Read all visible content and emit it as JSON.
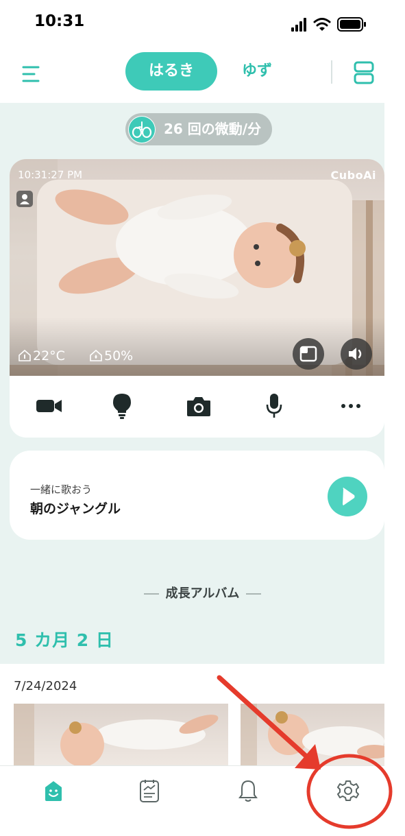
{
  "status_bar": {
    "time": "10:31",
    "icons": [
      "cellular-signal-icon",
      "wifi-icon",
      "battery-icon"
    ]
  },
  "header": {
    "menu_icon": "menu-icon",
    "tabs": [
      {
        "label": "はるき",
        "active": true
      },
      {
        "label": "ゆず",
        "active": false
      }
    ],
    "layout_icon": "split-layout-icon"
  },
  "breathing": {
    "icon": "lungs-icon",
    "text": "26 回の微動/分"
  },
  "camera": {
    "timestamp": "10:31:27 PM",
    "logo": "CuboAi",
    "temperature": "22°C",
    "humidity": "50%",
    "controls": [
      "video-camera-icon",
      "lightbulb-icon",
      "camera-icon",
      "microphone-icon",
      "more-icon"
    ]
  },
  "song": {
    "subtitle": "一緒に歌おう",
    "title": "朝のジャングル"
  },
  "album": {
    "heading": "成長アルバム",
    "age": "5 カ月 2 日",
    "date": "7/24/2024"
  },
  "tab_bar": {
    "items": [
      "home-icon",
      "journal-icon",
      "bell-icon",
      "settings-gear-icon"
    ],
    "active_index": 0
  },
  "colors": {
    "accent": "#3ecab8",
    "background": "#e9f3f1",
    "annotation": "#e53b2c"
  }
}
